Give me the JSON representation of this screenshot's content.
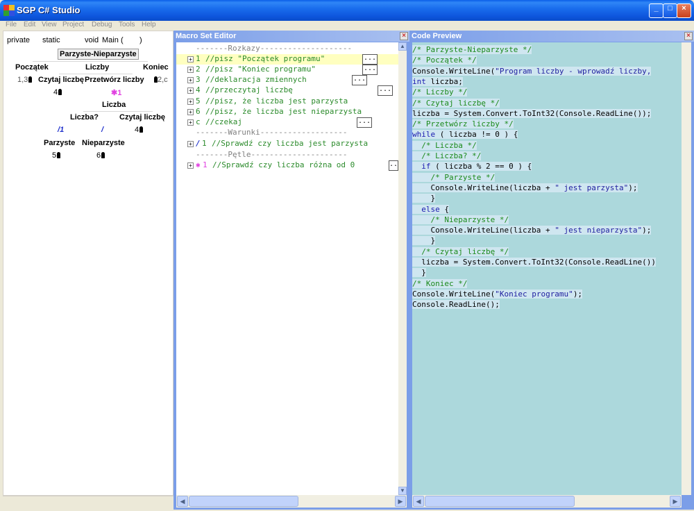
{
  "window": {
    "title": "SGP C# Studio",
    "buttons": [
      "_",
      "□",
      "×"
    ]
  },
  "menu": [
    "File",
    "Edit",
    "View",
    "Project",
    "Debug",
    "Tools",
    "Help"
  ],
  "left_panel": {
    "signature": {
      "access": "private",
      "modifier": "static",
      "type": "void",
      "name": "Main",
      "open": "(",
      "close": ")"
    },
    "root": "Parzyste-Nieparzyste",
    "level1": [
      "Początek",
      "Liczby",
      "Koniec"
    ],
    "level1_sub": {
      "left_num": "1,3",
      "czytaj": "Czytaj liczbę",
      "przetworz": "Przetwórz liczby",
      "right_num": "2,c"
    },
    "level2": {
      "four": "4",
      "star_num": "1",
      "liczba": "Liczba"
    },
    "level3": {
      "liczba_q": "Liczba?",
      "czytaj": "Czytaj liczbę",
      "slash_num": "1",
      "four": "4"
    },
    "level4": {
      "parzyste": "Parzyste",
      "nieparzyste": "Nieparzyste",
      "five": "5",
      "six": "6"
    }
  },
  "macro_editor": {
    "title": "Macro Set Editor",
    "lines": [
      {
        "kind": "sep",
        "text": "-------Rozkazy--------------------"
      },
      {
        "kind": "item",
        "num": "1",
        "text": "//pisz \"Początek programu\"",
        "dots": "..."
      },
      {
        "kind": "item",
        "num": "2",
        "text": "//pisz \"Koniec programu\"",
        "dots": "..."
      },
      {
        "kind": "item",
        "num": "3",
        "text": "//deklaracja zmiennych",
        "dots": "..."
      },
      {
        "kind": "item",
        "num": "4",
        "text": "//przeczytaj liczbę",
        "dots": "..."
      },
      {
        "kind": "item",
        "num": "5",
        "text": "//pisz, że liczba jest parzysta",
        "dots": ""
      },
      {
        "kind": "item",
        "num": "6",
        "text": "//pisz, że liczba jest nieparzysta",
        "dots": ""
      },
      {
        "kind": "item",
        "num": "c",
        "text": "//czekaj",
        "dots": "..."
      },
      {
        "kind": "sep",
        "text": "-------Warunki-------------------"
      },
      {
        "kind": "cond",
        "num": "1",
        "text": "//Sprawdź czy liczba jest parzysta"
      },
      {
        "kind": "sep",
        "text": "-------Pętle---------------------"
      },
      {
        "kind": "loop",
        "num": "1",
        "text": "//Sprawdź czy liczba różna od 0",
        "dots": "..."
      }
    ]
  },
  "code_preview": {
    "title": "Code Preview",
    "lines": [
      [
        {
          "c": "cmt",
          "t": "/* Parzyste-Nieparzyste */"
        }
      ],
      [
        {
          "c": "cmt",
          "t": "/* Początek */"
        }
      ],
      [
        {
          "c": "txt",
          "t": "Console.WriteLine("
        },
        {
          "c": "str",
          "t": "\"Program liczby - wprowadź liczby,"
        }
      ],
      [
        {
          "c": "kw",
          "t": "int"
        },
        {
          "c": "txt",
          "t": " liczba;"
        }
      ],
      [
        {
          "c": "cmt",
          "t": "/* Liczby */"
        }
      ],
      [
        {
          "c": "cmt",
          "t": "/* Czytaj liczbę */"
        }
      ],
      [
        {
          "c": "txt",
          "t": "liczba = System.Convert.ToInt32(Console.ReadLine());"
        }
      ],
      [
        {
          "c": "cmt",
          "t": "/* Przetwórz liczby */"
        }
      ],
      [
        {
          "c": "kw",
          "t": "while"
        },
        {
          "c": "txt",
          "t": " ( liczba != 0 ) {"
        }
      ],
      [
        {
          "c": "txt",
          "t": "  "
        },
        {
          "c": "cmt",
          "t": "/* Liczba */"
        }
      ],
      [
        {
          "c": "txt",
          "t": "  "
        },
        {
          "c": "cmt",
          "t": "/* Liczba? */"
        }
      ],
      [
        {
          "c": "txt",
          "t": "  "
        },
        {
          "c": "kw",
          "t": "if"
        },
        {
          "c": "txt",
          "t": " ( liczba % 2 == 0 ) {"
        }
      ],
      [
        {
          "c": "txt",
          "t": "    "
        },
        {
          "c": "cmt",
          "t": "/* Parzyste */"
        }
      ],
      [
        {
          "c": "txt",
          "t": "    Console.WriteLine(liczba + "
        },
        {
          "c": "str",
          "t": "\" jest parzysta\""
        },
        {
          "c": "txt",
          "t": ");"
        }
      ],
      [
        {
          "c": "txt",
          "t": "    }"
        }
      ],
      [
        {
          "c": "txt",
          "t": "  "
        },
        {
          "c": "kw",
          "t": "else"
        },
        {
          "c": "txt",
          "t": " {"
        }
      ],
      [
        {
          "c": "txt",
          "t": "    "
        },
        {
          "c": "cmt",
          "t": "/* Nieparzyste */"
        }
      ],
      [
        {
          "c": "txt",
          "t": "    Console.WriteLine(liczba + "
        },
        {
          "c": "str",
          "t": "\" jest nieparzysta\""
        },
        {
          "c": "txt",
          "t": ");"
        }
      ],
      [
        {
          "c": "txt",
          "t": "    }"
        }
      ],
      [
        {
          "c": "txt",
          "t": "  "
        },
        {
          "c": "cmt",
          "t": "/* Czytaj liczbę */"
        }
      ],
      [
        {
          "c": "txt",
          "t": "  liczba = System.Convert.ToInt32(Console.ReadLine())"
        }
      ],
      [
        {
          "c": "txt",
          "t": "  }"
        }
      ],
      [
        {
          "c": "cmt",
          "t": "/* Koniec */"
        }
      ],
      [
        {
          "c": "txt",
          "t": "Console.WriteLine("
        },
        {
          "c": "str",
          "t": "\"Koniec programu\""
        },
        {
          "c": "txt",
          "t": ");"
        }
      ],
      [
        {
          "c": "txt",
          "t": "Console.ReadLine();"
        }
      ]
    ]
  }
}
